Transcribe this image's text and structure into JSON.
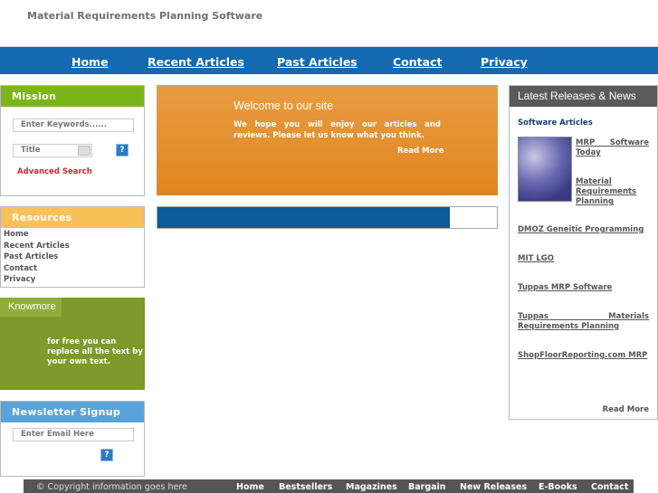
{
  "site_title": "Material Requirements Planning Software",
  "nav": [
    "Home",
    "Recent Articles",
    "Past Articles",
    "Contact",
    "Privacy"
  ],
  "mission": {
    "title": "Mission",
    "keywords_placeholder": "Enter Keywords......",
    "select_value": "Title",
    "help": "?",
    "advanced_search": "Advanced Search"
  },
  "resources": {
    "title": "Resources",
    "links": [
      "Home",
      "Recent Articles",
      "Past Articles",
      "Contact",
      "Privacy"
    ]
  },
  "knowmore": {
    "title": "Knowmore",
    "text": "for free you can replace all the text by your own text."
  },
  "newsletter": {
    "title": "Newsletter Signup",
    "email_placeholder": "Enter Email Here",
    "help": "?"
  },
  "welcome": {
    "title": "Welcome to our site",
    "text": "We hope you will enjoy our articles and reviews. Please let us know what you think.",
    "read_more": "Read More"
  },
  "news": {
    "title": "Latest Releases & News",
    "section": "Software Articles",
    "image_links": [
      "MRP Software Today",
      "Material Requirements Planning"
    ],
    "links": [
      "DMOZ Geneitic Programming",
      "MIT LGO",
      "Tuppas MRP Software",
      "Tuppas Materials Requirements Planning",
      "ShopFloorReporting.com MRP"
    ],
    "read_more": "Read More"
  },
  "footer": {
    "copyright": "© Copyright information goes here",
    "links": [
      "Home",
      "Bestsellers",
      "Magazines",
      "Bargain",
      "New Releases",
      "E-Books",
      "Contact"
    ]
  },
  "colors": {
    "nav": "#1469b0",
    "mission": "#7cb518",
    "resources": "#f9c05a",
    "knowmore": "#7d9a2a",
    "newsletter": "#58a3dc",
    "news_header": "#5a5a5a",
    "banner": "#e38a22",
    "footer": "#555555"
  }
}
